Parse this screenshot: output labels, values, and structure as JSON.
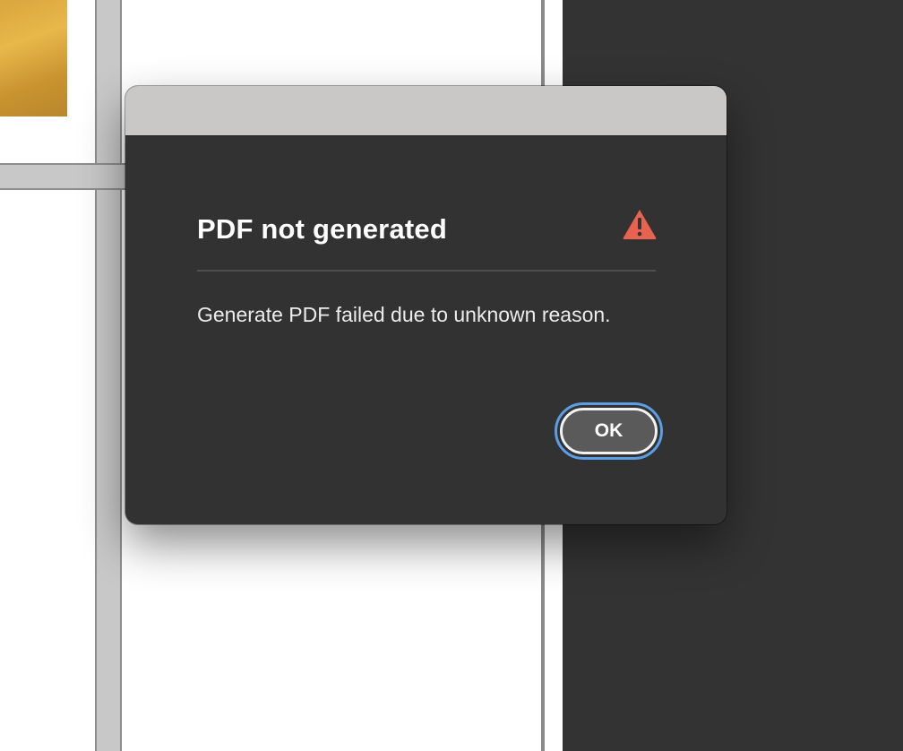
{
  "dialog": {
    "title": "PDF not generated",
    "message": "Generate PDF failed due to unknown reason.",
    "icon": "warning-icon",
    "ok_label": "OK"
  },
  "colors": {
    "warning_icon": "#e8634f",
    "focus_ring": "#5a9ee6",
    "dialog_background": "#323232",
    "titlebar": "#c9c8c6"
  }
}
